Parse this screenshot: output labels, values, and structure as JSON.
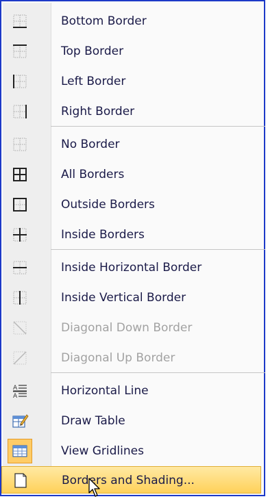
{
  "menu": {
    "items": [
      {
        "label": "Bottom Border",
        "icon": "bottom-border-icon",
        "enabled": true
      },
      {
        "label": "Top Border",
        "icon": "top-border-icon",
        "enabled": true
      },
      {
        "label": "Left Border",
        "icon": "left-border-icon",
        "enabled": true
      },
      {
        "label": "Right Border",
        "icon": "right-border-icon",
        "enabled": true
      },
      {
        "label": "No Border",
        "icon": "no-border-icon",
        "enabled": true
      },
      {
        "label": "All Borders",
        "icon": "all-borders-icon",
        "enabled": true
      },
      {
        "label": "Outside Borders",
        "icon": "outside-borders-icon",
        "enabled": true
      },
      {
        "label": "Inside Borders",
        "icon": "inside-borders-icon",
        "enabled": true
      },
      {
        "label": "Inside Horizontal Border",
        "icon": "inside-horizontal-border-icon",
        "enabled": true
      },
      {
        "label": "Inside Vertical Border",
        "icon": "inside-vertical-border-icon",
        "enabled": true
      },
      {
        "label": "Diagonal Down Border",
        "icon": "diagonal-down-border-icon",
        "enabled": false
      },
      {
        "label": "Diagonal Up Border",
        "icon": "diagonal-up-border-icon",
        "enabled": false
      },
      {
        "label": "Horizontal Line",
        "icon": "horizontal-line-icon",
        "enabled": true
      },
      {
        "label": "Draw Table",
        "icon": "draw-table-icon",
        "enabled": true
      },
      {
        "label": "View Gridlines",
        "icon": "view-gridlines-icon",
        "enabled": true,
        "checked": true
      },
      {
        "label": "Borders and Shading...",
        "icon": "borders-and-shading-icon",
        "enabled": true,
        "hovered": true
      }
    ]
  },
  "colors": {
    "frame": "#1c39c8",
    "hover": "#ffd86c",
    "text": "#1a1a48",
    "disabled": "#a2a2a2"
  }
}
